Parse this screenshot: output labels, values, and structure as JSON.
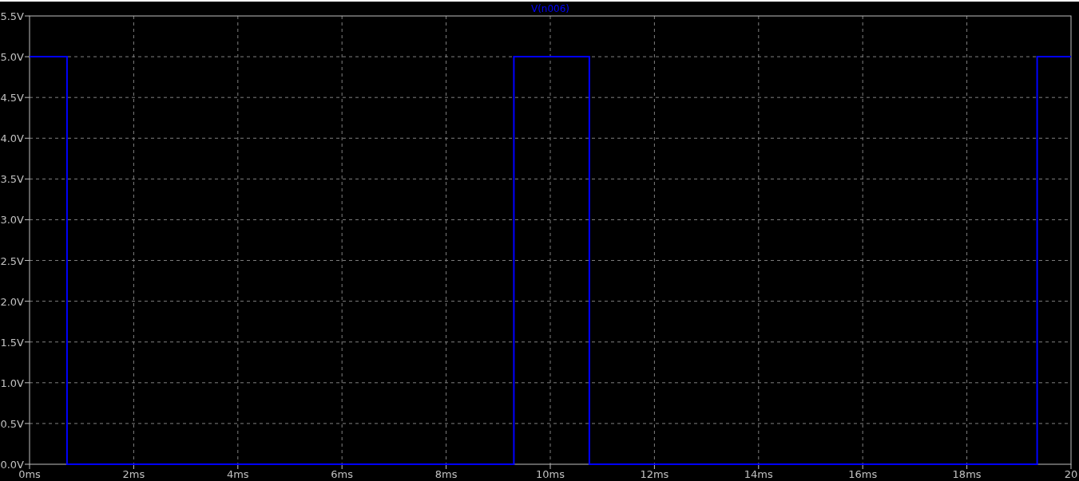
{
  "chart_data": {
    "type": "line",
    "grid": true,
    "x": [
      0,
      0.72,
      0.72,
      9.3,
      9.3,
      10.75,
      10.75,
      19.35,
      19.35,
      20
    ],
    "series": [
      {
        "name": "V(n006)",
        "color": "#0000ff",
        "values": [
          5,
          5,
          0,
          0,
          5,
          5,
          0,
          0,
          5,
          5
        ]
      }
    ],
    "xlim": [
      0,
      20
    ],
    "ylim": [
      0,
      5.5
    ],
    "xticks": [
      {
        "value": 0,
        "label": "0ms"
      },
      {
        "value": 2,
        "label": "2ms"
      },
      {
        "value": 4,
        "label": "4ms"
      },
      {
        "value": 6,
        "label": "6ms"
      },
      {
        "value": 8,
        "label": "8ms"
      },
      {
        "value": 10,
        "label": "10ms"
      },
      {
        "value": 12,
        "label": "12ms"
      },
      {
        "value": 14,
        "label": "14ms"
      },
      {
        "value": 16,
        "label": "16ms"
      },
      {
        "value": 18,
        "label": "18ms"
      },
      {
        "value": 20,
        "label": "20"
      }
    ],
    "yticks": [
      {
        "value": 0,
        "label": "0.0V"
      },
      {
        "value": 0.5,
        "label": "0.5V"
      },
      {
        "value": 1,
        "label": "1.0V"
      },
      {
        "value": 1.5,
        "label": "1.5V"
      },
      {
        "value": 2,
        "label": "2.0V"
      },
      {
        "value": 2.5,
        "label": "2.5V"
      },
      {
        "value": 3,
        "label": "3.0V"
      },
      {
        "value": 3.5,
        "label": "3.5V"
      },
      {
        "value": 4,
        "label": "4.0V"
      },
      {
        "value": 4.5,
        "label": "4.5V"
      },
      {
        "value": 5,
        "label": "5.0V"
      },
      {
        "value": 5.5,
        "label": "5.5V"
      }
    ]
  }
}
